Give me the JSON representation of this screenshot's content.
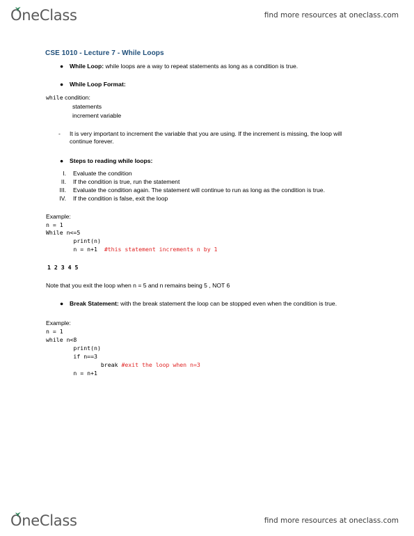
{
  "header": {
    "brand": "OneClass",
    "leaf_color": "#1f7a4d",
    "promo": "find more resources at oneclass.com"
  },
  "footer": {
    "brand": "OneClass",
    "promo": "find more resources at oneclass.com"
  },
  "document": {
    "title": "CSE 1010 - Lecture 7 - While Loops",
    "title_color": "#1f4e79",
    "comment_color": "#e02323",
    "sections": {
      "while_loop_bullet": {
        "marker": "●",
        "label": "While Loop:",
        "text": " while loops are a way to repeat statements as long as a condition is true."
      },
      "while_loop_format_bullet": {
        "marker": "●",
        "label": "While Loop Format:"
      },
      "format_block": {
        "line1_mono": "while",
        "line1_rest": " condition:",
        "line2": "statements",
        "line3": "increment variable"
      },
      "increment_note": {
        "marker": "-",
        "text": "It is very important to increment the variable that you are using. If the increment is missing, the loop will continue forever."
      },
      "steps_bullet": {
        "marker": "●",
        "label": "Steps to reading while loops:"
      },
      "steps": [
        {
          "numeral": "I.",
          "text": "Evaluate the condition"
        },
        {
          "numeral": "II.",
          "text": "If the condition is true, run the statement"
        },
        {
          "numeral": "III.",
          "text": "Evaluate the condition again. The statement will continue to run as long as the condition is true."
        },
        {
          "numeral": "IV.",
          "text": "If the condition is false, exit the loop"
        }
      ],
      "example1": {
        "label": "Example:",
        "code_lines": [
          {
            "text": "n = 1",
            "comment": ""
          },
          {
            "text": "While n<=5",
            "comment": ""
          },
          {
            "text": "        print(n)",
            "comment": ""
          },
          {
            "text": "        n = n+1  ",
            "comment": "#this statement increments n by 1"
          }
        ],
        "output": [
          "1",
          "2",
          "3",
          "4",
          "5"
        ]
      },
      "note_text": "Note that you exit the loop when n = 5 and n remains being 5 , NOT 6",
      "break_bullet": {
        "marker": "●",
        "label": "Break Statement:",
        "text": " with the break statement the loop can be stopped even when the condition is true."
      },
      "example2": {
        "label": "Example:",
        "code_lines": [
          {
            "text": "n = 1",
            "comment": ""
          },
          {
            "text": "while n<8",
            "comment": ""
          },
          {
            "text": "        print(n)",
            "comment": ""
          },
          {
            "text": "        if n==3",
            "comment": ""
          },
          {
            "text": "                break ",
            "comment": "#exit the loop when n=3"
          },
          {
            "text": "        n = n+1",
            "comment": ""
          }
        ]
      }
    }
  }
}
